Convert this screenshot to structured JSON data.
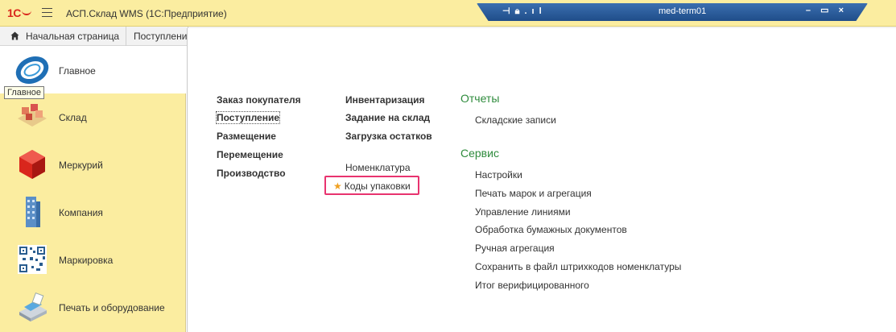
{
  "titlebar": {
    "logo_text": "1С",
    "app_title": "АСП.Склад WMS  (1С:Предприятие)"
  },
  "remote_bar": {
    "host": "med-term01",
    "controls": [
      "–",
      "▭",
      "×"
    ]
  },
  "tabs": [
    {
      "label": "Начальная страница",
      "icon": "home-icon"
    },
    {
      "label": "Поступление"
    }
  ],
  "tooltip": "Главное",
  "sidebar": {
    "items": [
      {
        "label": "Главное",
        "icon": "main-logo-icon",
        "active": true
      },
      {
        "label": "Склад",
        "icon": "warehouse-icon"
      },
      {
        "label": "Меркурий",
        "icon": "mercury-cube-icon"
      },
      {
        "label": "Компания",
        "icon": "company-building-icon"
      },
      {
        "label": "Маркировка",
        "icon": "qr-code-icon"
      },
      {
        "label": "Печать и оборудование",
        "icon": "printer-equipment-icon"
      }
    ]
  },
  "content": {
    "col1": [
      "Заказ покупателя",
      "Поступление",
      "Размещение",
      "Перемещение",
      "Производство"
    ],
    "col2_bold": [
      "Инвентаризация",
      "Задание на склад",
      "Загрузка остатков"
    ],
    "col2_regular": [
      "Номенклатура",
      "Коды упаковки"
    ],
    "reports": {
      "title": "Отчеты",
      "items": [
        "Складские записи"
      ]
    },
    "service": {
      "title": "Сервис",
      "items": [
        "Настройки",
        "Печать марок и агрегация",
        "Управление линиями",
        "Обработка бумажных документов",
        "Ручная агрегация",
        "Сохранить в файл штрихкодов номенклатуры",
        "Итог верифицированного"
      ]
    }
  },
  "colors": {
    "sidebar_bg": "#fbeda0",
    "section_title": "#2e8b3c",
    "highlight_border": "#e8336f",
    "remote_bar": "#1f4d89"
  }
}
